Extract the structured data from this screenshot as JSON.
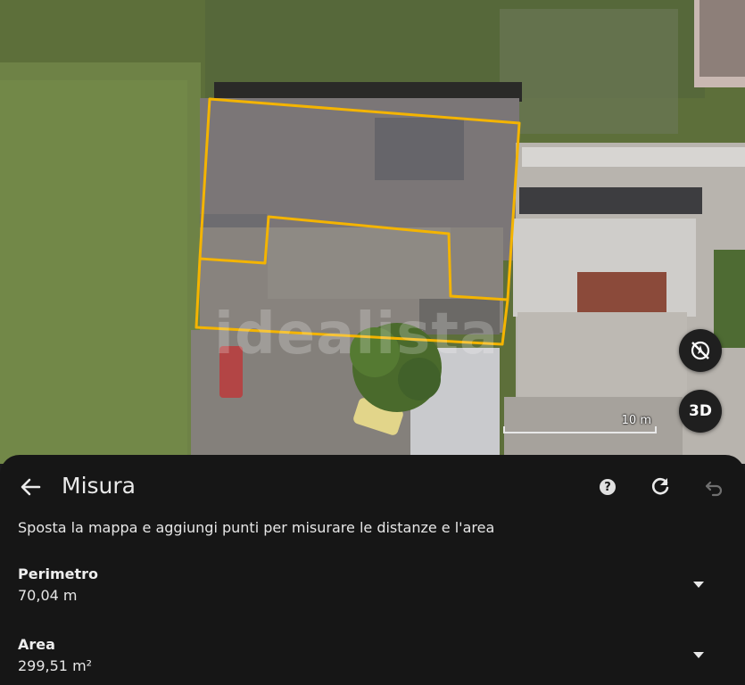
{
  "map": {
    "watermark": "idealista",
    "scale_label": "10 m",
    "compass_icon": "compass-reset-icon",
    "view_3d_label": "3D",
    "measure_outline_color": "#f4b400"
  },
  "panel": {
    "title": "Misura",
    "instructions": "Sposta la mappa e aggiungi punti per misurare le distanze e l'area",
    "perimeter_label": "Perimetro",
    "perimeter_value": "70,04 m",
    "area_label": "Area",
    "area_value": "299,51 m²"
  }
}
